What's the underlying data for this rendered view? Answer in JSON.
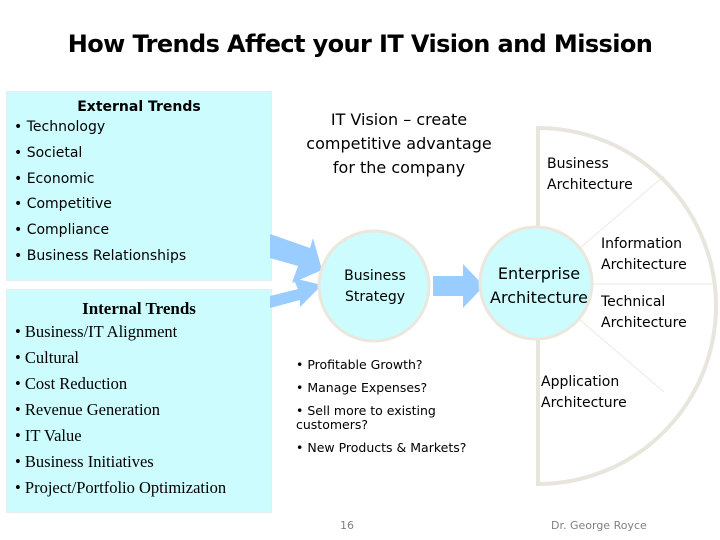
{
  "slide": {
    "title": "How Trends Affect your IT Vision and Mission",
    "page_number": "16",
    "author": "Dr. George Royce"
  },
  "external_trends": {
    "heading": "External Trends",
    "items": [
      "• Technology",
      "• Societal",
      "• Economic",
      "• Competitive",
      "• Compliance",
      "• Business Relationships"
    ]
  },
  "internal_trends": {
    "heading": "Internal Trends",
    "items": [
      "• Business/IT Alignment",
      "• Cultural",
      "• Cost Reduction",
      "• Revenue Generation",
      "• IT Value",
      "• Business Initiatives",
      "• Project/Portfolio Optimization"
    ]
  },
  "vision": {
    "line1": "IT Vision – create",
    "line2": "competitive advantage",
    "line3": "for the company"
  },
  "business_strategy": {
    "line1": "Business",
    "line2": "Strategy",
    "questions": [
      "• Profitable Growth?",
      "• Manage Expenses?",
      "• Sell more to existing customers?",
      "•  New Products & Markets?"
    ]
  },
  "enterprise_architecture": {
    "line1": "Enterprise",
    "line2": "Architecture",
    "segments": [
      {
        "line1": "Business",
        "line2": "Architecture"
      },
      {
        "line1": "Information",
        "line2": "Architecture"
      },
      {
        "line1": "Technical",
        "line2": "Architecture"
      },
      {
        "line1": "Application",
        "line2": "Architecture"
      }
    ]
  },
  "colors": {
    "box_fill": "#ccfcfe",
    "circle_fill": "#ccfcfe",
    "circle_border": "#ebe7dc",
    "arrow_fill": "#99ccff",
    "fan_border": "#e8e6dc"
  }
}
